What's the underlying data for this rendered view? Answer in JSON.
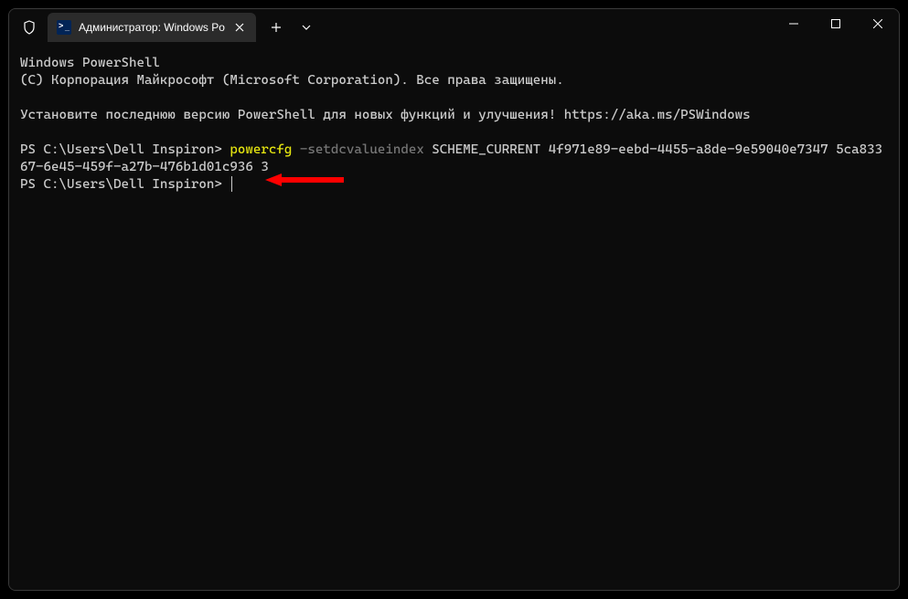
{
  "titlebar": {
    "tab_title": "Администратор: Windows Po"
  },
  "terminal": {
    "line1": "Windows PowerShell",
    "line2": "(C) Корпорация Майкрософт (Microsoft Corporation). Все права защищены.",
    "line3": "Установите последнюю версию PowerShell для новых функций и улучшения! https://aka.ms/PSWindows",
    "prompt1": "PS C:\\Users\\Dell Inspiron> ",
    "cmd_name": "powercfg",
    "cmd_flag": " -setdcvalueindex",
    "cmd_args": " SCHEME_CURRENT 4f971e89-eebd-4455-a8de-9e59040e7347 5ca83367-6e45-459f-a27b-476b1d01c936 3",
    "prompt2": "PS C:\\Users\\Dell Inspiron> "
  }
}
